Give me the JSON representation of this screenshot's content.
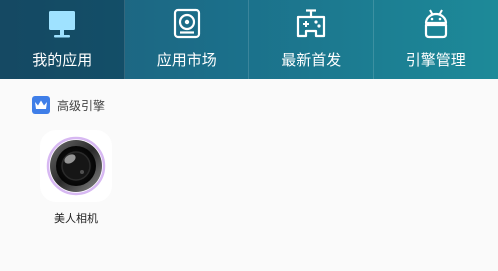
{
  "nav": {
    "tabs": [
      {
        "label": "我的应用",
        "icon": "monitor-icon",
        "active": true
      },
      {
        "label": "应用市场",
        "icon": "disc-drive-icon",
        "active": false
      },
      {
        "label": "最新首发",
        "icon": "gamepad-icon",
        "active": false
      },
      {
        "label": "引擎管理",
        "icon": "android-icon",
        "active": false
      }
    ]
  },
  "section": {
    "title": "高级引擎",
    "badge_icon": "crown-icon"
  },
  "apps": [
    {
      "label": "美人相机",
      "icon": "camera-lens-icon"
    }
  ],
  "colors": {
    "topbar_start": "#1f5d7a",
    "topbar_end": "#1d8a99",
    "badge": "#3f7ee8",
    "background": "#fafafa"
  }
}
